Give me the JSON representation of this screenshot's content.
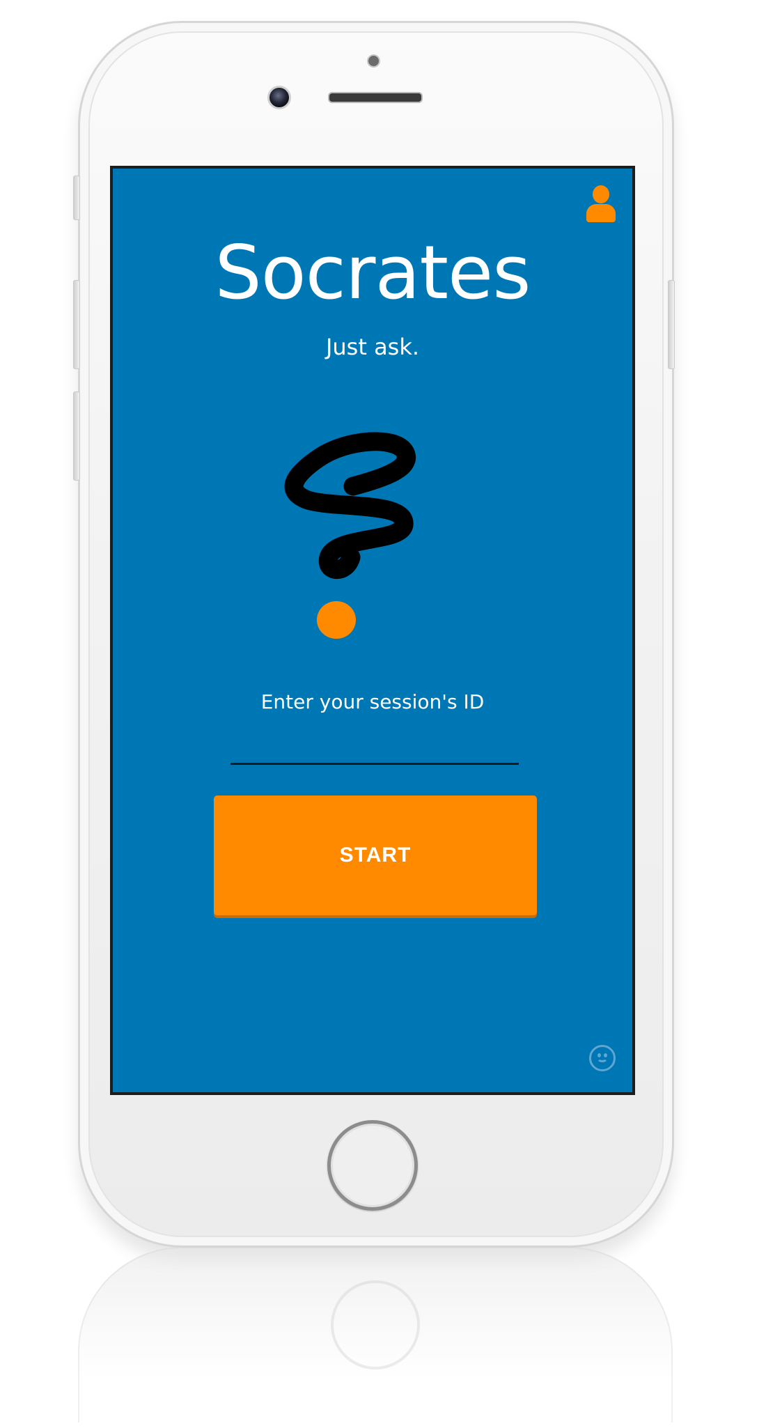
{
  "app": {
    "title": "Socrates",
    "tagline": "Just ask."
  },
  "session": {
    "prompt": "Enter your session's ID",
    "input_value": "",
    "input_placeholder": ""
  },
  "actions": {
    "start_label": "START"
  },
  "icons": {
    "profile": "user-icon",
    "feedback": "smiley-icon",
    "logo": "question-mark-logo"
  },
  "colors": {
    "screen_background": "#0077b5",
    "accent": "#ff8a00",
    "text": "#ffffff",
    "logo_stroke": "#000000"
  }
}
